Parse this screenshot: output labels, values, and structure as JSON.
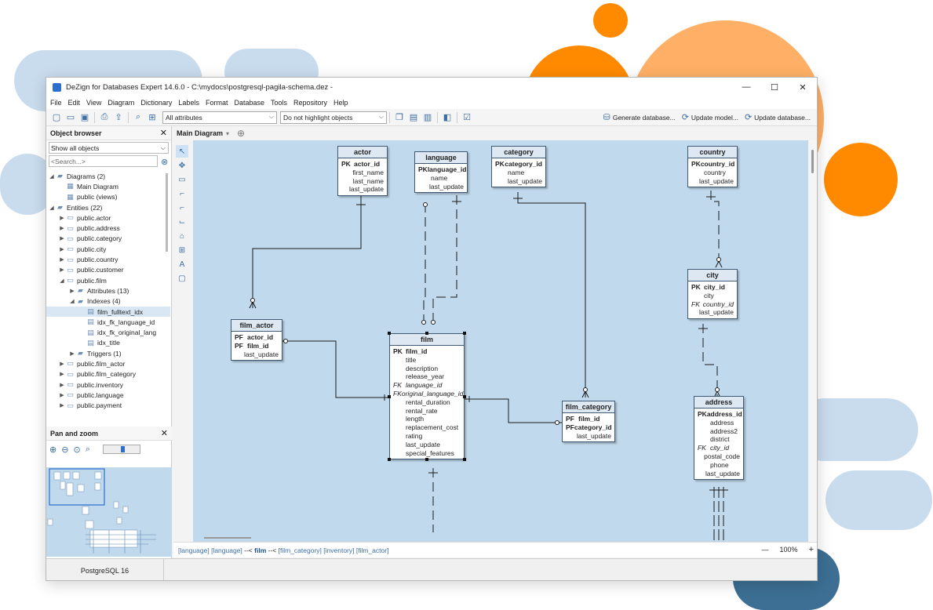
{
  "window": {
    "title": "DeZign for Databases Expert 14.6.0 - C:\\mydocs\\postgresql-pagila-schema.dez -",
    "min": "—",
    "max": "☐",
    "close": "✕"
  },
  "menu": [
    "File",
    "Edit",
    "View",
    "Diagram",
    "Dictionary",
    "Labels",
    "Format",
    "Database",
    "Tools",
    "Repository",
    "Help"
  ],
  "toolbar": {
    "attributes_select": "All attributes",
    "highlight_select": "Do not highlight objects",
    "generate_database": "Generate database...",
    "update_model": "Update model...",
    "update_database": "Update database..."
  },
  "object_browser": {
    "title": "Object browser",
    "filter": "Show all objects",
    "search_placeholder": "<Search...>",
    "tree": [
      {
        "level": 0,
        "caret": "◢",
        "icon": "folder",
        "label": "Diagrams (2)"
      },
      {
        "level": 1,
        "caret": "",
        "icon": "diagram",
        "label": "Main Diagram"
      },
      {
        "level": 1,
        "caret": "",
        "icon": "diagram",
        "label": "public (views)"
      },
      {
        "level": 0,
        "caret": "◢",
        "icon": "folder",
        "label": "Entities (22)"
      },
      {
        "level": 1,
        "caret": "▶",
        "icon": "table",
        "label": "public.actor"
      },
      {
        "level": 1,
        "caret": "▶",
        "icon": "table",
        "label": "public.address"
      },
      {
        "level": 1,
        "caret": "▶",
        "icon": "table",
        "label": "public.category"
      },
      {
        "level": 1,
        "caret": "▶",
        "icon": "table",
        "label": "public.city"
      },
      {
        "level": 1,
        "caret": "▶",
        "icon": "table",
        "label": "public.country"
      },
      {
        "level": 1,
        "caret": "▶",
        "icon": "table",
        "label": "public.customer"
      },
      {
        "level": 1,
        "caret": "◢",
        "icon": "table",
        "label": "public.film"
      },
      {
        "level": 2,
        "caret": "▶",
        "icon": "folder",
        "label": "Attributes (13)"
      },
      {
        "level": 2,
        "caret": "◢",
        "icon": "folder",
        "label": "Indexes (4)"
      },
      {
        "level": 3,
        "caret": "",
        "icon": "index",
        "label": "film_fulltext_idx",
        "selected": true
      },
      {
        "level": 3,
        "caret": "",
        "icon": "index",
        "label": "idx_fk_language_id"
      },
      {
        "level": 3,
        "caret": "",
        "icon": "index",
        "label": "idx_fk_original_lang"
      },
      {
        "level": 3,
        "caret": "",
        "icon": "index",
        "label": "idx_title"
      },
      {
        "level": 2,
        "caret": "▶",
        "icon": "folder",
        "label": "Triggers (1)"
      },
      {
        "level": 1,
        "caret": "▶",
        "icon": "table",
        "label": "public.film_actor"
      },
      {
        "level": 1,
        "caret": "▶",
        "icon": "table",
        "label": "public.film_category"
      },
      {
        "level": 1,
        "caret": "▶",
        "icon": "table",
        "label": "public.inventory"
      },
      {
        "level": 1,
        "caret": "▶",
        "icon": "table",
        "label": "public.language"
      },
      {
        "level": 1,
        "caret": "▶",
        "icon": "table",
        "label": "public.payment"
      }
    ]
  },
  "pan_zoom": {
    "title": "Pan and zoom"
  },
  "diagram_tab": {
    "label": "Main Diagram"
  },
  "entities": [
    {
      "id": "actor",
      "name": "actor",
      "rows": [
        [
          "PK",
          "actor_id",
          "pk"
        ],
        [
          "",
          "first_name",
          ""
        ],
        [
          "",
          "last_name",
          ""
        ],
        [
          "",
          "last_update",
          ""
        ]
      ]
    },
    {
      "id": "language",
      "name": "language",
      "rows": [
        [
          "PK",
          "language_id",
          "pk"
        ],
        [
          "",
          "name",
          ""
        ],
        [
          "",
          "last_update",
          ""
        ]
      ]
    },
    {
      "id": "category",
      "name": "category",
      "rows": [
        [
          "PK",
          "category_id",
          "pk"
        ],
        [
          "",
          "name",
          ""
        ],
        [
          "",
          "last_update",
          ""
        ]
      ]
    },
    {
      "id": "country",
      "name": "country",
      "rows": [
        [
          "PK",
          "country_id",
          "pk"
        ],
        [
          "",
          "country",
          ""
        ],
        [
          "",
          "last_update",
          ""
        ]
      ]
    },
    {
      "id": "city",
      "name": "city",
      "rows": [
        [
          "PK",
          "city_id",
          "pk"
        ],
        [
          "",
          "city",
          ""
        ],
        [
          "FK",
          "country_id",
          "fk"
        ],
        [
          "",
          "last_update",
          ""
        ]
      ]
    },
    {
      "id": "film_actor",
      "name": "film_actor",
      "rows": [
        [
          "PF",
          "actor_id",
          "pk"
        ],
        [
          "PF",
          "film_id",
          "pk"
        ],
        [
          "",
          "last_update",
          ""
        ]
      ]
    },
    {
      "id": "film",
      "name": "film",
      "rows": [
        [
          "PK",
          "film_id",
          "pk"
        ],
        [
          "",
          "title",
          ""
        ],
        [
          "",
          "description",
          ""
        ],
        [
          "",
          "release_year",
          ""
        ],
        [
          "FK",
          "language_id",
          "fk"
        ],
        [
          "FK",
          "original_language_id",
          "fk"
        ],
        [
          "",
          "rental_duration",
          ""
        ],
        [
          "",
          "rental_rate",
          ""
        ],
        [
          "",
          "length",
          ""
        ],
        [
          "",
          "replacement_cost",
          ""
        ],
        [
          "",
          "rating",
          ""
        ],
        [
          "",
          "last_update",
          ""
        ],
        [
          "",
          "special_features",
          ""
        ]
      ]
    },
    {
      "id": "film_category",
      "name": "film_category",
      "rows": [
        [
          "PF",
          "film_id",
          "pk"
        ],
        [
          "PF",
          "category_id",
          "pk"
        ],
        [
          "",
          "last_update",
          ""
        ]
      ]
    },
    {
      "id": "address",
      "name": "address",
      "rows": [
        [
          "PK",
          "address_id",
          "pk"
        ],
        [
          "",
          "address",
          ""
        ],
        [
          "",
          "address2",
          ""
        ],
        [
          "",
          "district",
          ""
        ],
        [
          "FK",
          "city_id",
          "fk"
        ],
        [
          "",
          "postal_code",
          ""
        ],
        [
          "",
          "phone",
          ""
        ],
        [
          "",
          "last_update",
          ""
        ]
      ]
    }
  ],
  "status_line": {
    "links": [
      "[language]",
      "[language]"
    ],
    "arrow1": " --< ",
    "current": "film",
    "arrow2": " --< ",
    "links2": [
      "[film_category]",
      "[inventory]",
      "[film_actor]"
    ]
  },
  "zoom": {
    "minus": "—",
    "value": "100%",
    "plus": "+"
  },
  "statusbar": {
    "db": "PostgreSQL 16"
  },
  "colors": {
    "canvas": "#c0d9ec",
    "accent": "#3a6ea5",
    "orange": "#ff8a00",
    "light_orange": "#ffb066",
    "light_blue": "#c9dcee",
    "dark_blue": "#3c6f93"
  }
}
